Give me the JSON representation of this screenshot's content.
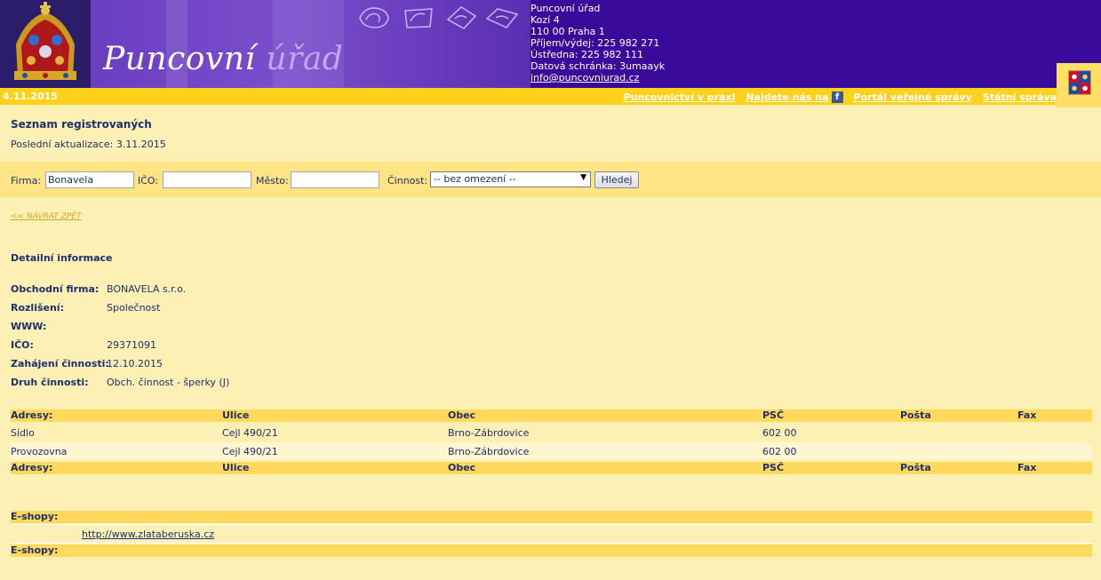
{
  "header": {
    "logo_main": "Puncovní",
    "logo_dim": "úřad",
    "contact": {
      "org": "Puncovní úřad",
      "street": "Kozí 4",
      "city": "110 00 Praha 1",
      "phone_cash": "Příjem/výdej: 225 982 271",
      "phone_main": "Ústředna: 225 982 111",
      "data_box": "Datová schránka: 3umaayk",
      "email": "info@puncovniurad.cz"
    }
  },
  "navbar": {
    "date": "4.11.2015",
    "links": {
      "praxis": "Puncovnictví v praxi",
      "facebook": "Najdete nás na",
      "facebook_icon": "f",
      "portal": "Portál veřejné správy",
      "state": "Státní správa"
    }
  },
  "main": {
    "title": "Seznam registrovaných",
    "updated": "Poslední aktualizace: 3.11.2015"
  },
  "search": {
    "firm_label": "Firma:",
    "firm_value": "Bonavela",
    "ico_label": "IČO:",
    "ico_value": "",
    "city_label": "Město:",
    "city_value": "",
    "activity_label": "Činnost:",
    "activity_value": "-- bez omezení --",
    "button_label": "Hledej"
  },
  "back_link": "<< NÁVRAT ZPĚT",
  "detail": {
    "title": "Detailní informace",
    "rows": [
      {
        "key": "Obchodní firma:",
        "value": "BONAVELA s.r.o."
      },
      {
        "key": "Rozlišení:",
        "value": "Společnost"
      },
      {
        "key": "WWW:",
        "value": ""
      },
      {
        "key": "IČO:",
        "value": "29371091"
      },
      {
        "key": "Zahájení činnosti:",
        "value": "12.10.2015"
      },
      {
        "key": "Druh činnosti:",
        "value": "Obch. činnost - šperky (J)"
      }
    ]
  },
  "addresses": {
    "headers": {
      "type": "Adresy:",
      "street": "Ulice",
      "city": "Obec",
      "zip": "PSČ",
      "post": "Pošta",
      "fax": "Fax"
    },
    "rows": [
      {
        "type": "Sídlo",
        "street": "Cejl 490/21",
        "city": "Brno-Zábrdovice",
        "zip": "602 00",
        "post": "",
        "fax": ""
      },
      {
        "type": "Provozovna",
        "street": "Cejl 490/21",
        "city": "Brno-Zábrdovice",
        "zip": "602 00",
        "post": "",
        "fax": ""
      }
    ]
  },
  "eshops": {
    "header": "E-shopy:",
    "items": [
      "http://www.zlataberuska.cz"
    ]
  },
  "colors": {
    "header_bg": "#3a0a9a",
    "navbar_bg": "#ffd11a",
    "page_bg": "#fdf0b4",
    "text": "#1d2f6e"
  }
}
